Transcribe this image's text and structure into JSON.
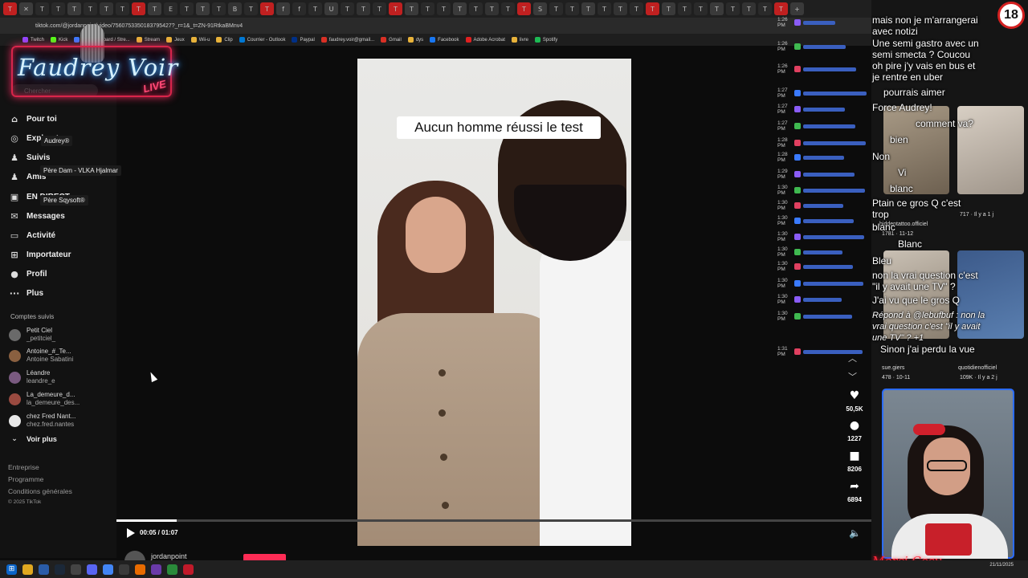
{
  "browser": {
    "tab_glyphs": [
      "T",
      "✕",
      "T",
      "T",
      "T",
      "T",
      "T",
      "T",
      "T",
      "T",
      "E",
      "T",
      "T",
      "T",
      "B",
      "T",
      "T",
      "f",
      "f",
      "T",
      "U",
      "T",
      "T",
      "T",
      "T",
      "T",
      "T",
      "T",
      "T",
      "T",
      "T",
      "T",
      "T",
      "S",
      "T",
      "T",
      "T",
      "T",
      "T",
      "T",
      "T",
      "T",
      "T",
      "T",
      "T",
      "T",
      "T",
      "T",
      "T",
      "+"
    ],
    "url": "tiktok.com/@jordanpoint/video/7560753350183795427?_r=1&_t=ZN-91RtkaBMnv4",
    "bookmarks": [
      "Twitch",
      "Kick",
      "(4) Dashboard / Stre...",
      "Stream",
      "Jeux",
      "Wii-u",
      "Clip",
      "Courrier - Outlook",
      "Paypal",
      "faudrey.voir@gmail...",
      "Gmail",
      "dys",
      "Facebook",
      "Adobe Acrobat",
      "livre",
      "Spotify"
    ]
  },
  "logo": {
    "title": "Faudrey Voir",
    "badge": "LIVE"
  },
  "sidebar": {
    "search_placeholder": "Chercher",
    "nav": [
      {
        "label": "Pour toi",
        "icon": "home-icon"
      },
      {
        "label": "Explorateur",
        "icon": "compass-icon"
      },
      {
        "label": "Suivis",
        "icon": "users-icon"
      },
      {
        "label": "Amis",
        "icon": "friends-icon"
      },
      {
        "label": "EN DIRECT",
        "icon": "live-icon"
      },
      {
        "label": "Messages",
        "icon": "message-icon"
      },
      {
        "label": "Activité",
        "icon": "activity-icon"
      },
      {
        "label": "Importateur",
        "icon": "upload-icon"
      },
      {
        "label": "Profil",
        "icon": "profile-icon"
      },
      {
        "label": "Plus",
        "icon": "more-icon"
      }
    ],
    "tooltips": [
      "Audrey®",
      "Père Dam - VLKA Hjalmar",
      "Père Sqysoft®"
    ],
    "following_title": "Comptes suivis",
    "following": [
      {
        "name": "Petit Ciel",
        "handle": "_petitciel_"
      },
      {
        "name": "Antoine_#_Te...",
        "handle": "Antoine Sabatini"
      },
      {
        "name": "Léandre",
        "handle": "leandre_e"
      },
      {
        "name": "La_demeure_d...",
        "handle": "la_demeure_des..."
      },
      {
        "name": "chez Fred Nant...",
        "handle": "chez.fred.nantes"
      }
    ],
    "see_more": "Voir plus",
    "footer": [
      "Entreprise",
      "Programme",
      "Conditions générales",
      "© 2025 TikTok"
    ]
  },
  "video": {
    "caption": "Aucun homme réussi le test",
    "progress": 0.08,
    "time": "00:05 / 01:07",
    "author": "jordanpoint"
  },
  "actions": [
    {
      "icon": "heart-icon",
      "glyph": "♥",
      "count": "50,5K"
    },
    {
      "icon": "comment-icon",
      "glyph": "●",
      "count": "1227"
    },
    {
      "icon": "bookmark-icon",
      "glyph": "■",
      "count": "8206"
    },
    {
      "icon": "share-icon",
      "glyph": "➦",
      "count": "6894"
    }
  ],
  "chatlog_times": [
    "1:26 PM",
    "1:26 PM",
    "1:26 PM",
    "1:27 PM",
    "1:27 PM",
    "1:27 PM",
    "1:28 PM",
    "1:28 PM",
    "1:29 PM",
    "1:30 PM",
    "1:30 PM",
    "1:30 PM",
    "1:30 PM",
    "1:30 PM",
    "1:30 PM",
    "1:30 PM",
    "1:30 PM",
    "1:30 PM",
    "1:31 PM"
  ],
  "chat_overlay": [
    "mais non je m'arrangerai\navec notizi",
    "Une semi gastro avec un\nsemi smecta ? Coucou",
    "oh pire j'y vais en bus et\nje rentre en uber",
    "pourrais aimer",
    "Force Audrey!",
    "comment va?",
    "bien",
    "Non",
    "Vi",
    "blanc",
    "Ptain ce gros Q c'est\ntrop",
    "blanc",
    "Blanc",
    "Bleu",
    "non la vrai question c'est\n\"il y avait une TV\" ?",
    "J'ai vu que le gros Q",
    "Répond à @lebufbuf : non la\nvrai question c'est \"il y avait\nune TV\" ? +1",
    "Sinon j'ai perdu la vue"
  ],
  "right_meta": [
    "717 · Il y a 1 j",
    "1781 · 11-12",
    "478 · 10-11",
    "109K · Il y a 2 j",
    "sue.giers",
    "quotidienofficiel",
    "hiddentattoo.officiel"
  ],
  "badge18": "18",
  "signature": "Merci Cosy...",
  "taskbar": {
    "clock_time": "",
    "clock_date": "21/11/2025"
  },
  "colors": {
    "accent": "#fe2c55",
    "logo_pink": "#d9254a",
    "logo_blue": "#3fb6ff",
    "webcam_border": "#2b6cff"
  }
}
